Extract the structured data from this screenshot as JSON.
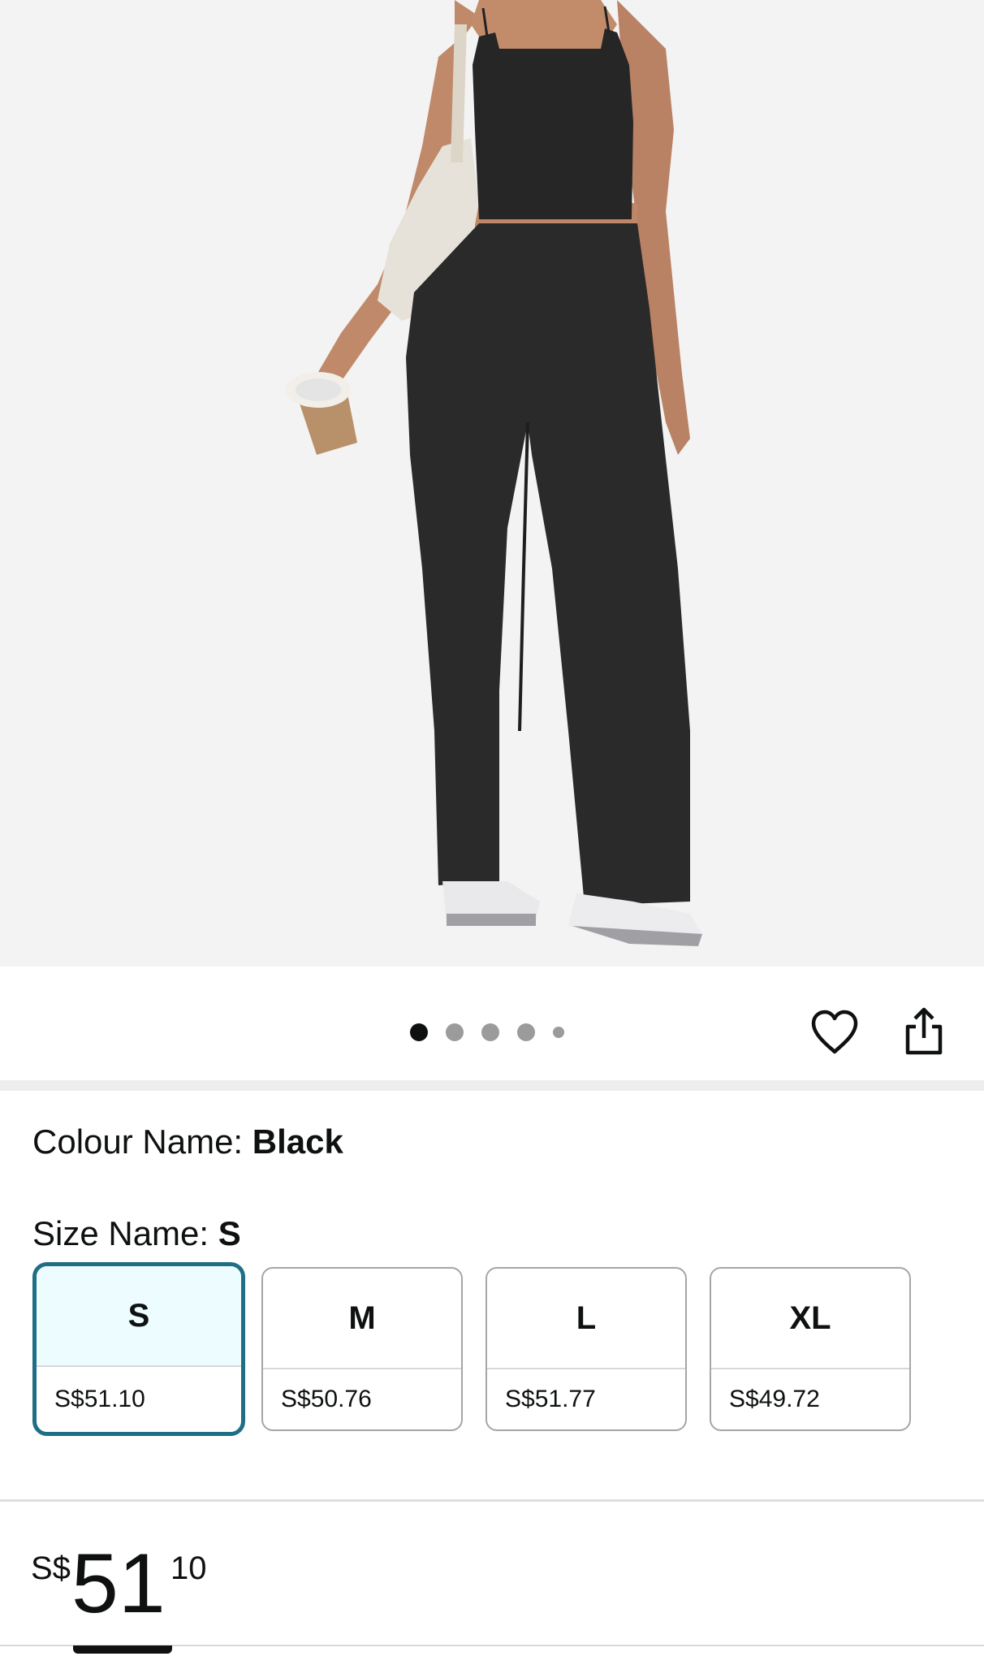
{
  "product": {
    "image_alt": "Model wearing black cropped cami top and black wide-leg pants, holding a tote bag and coffee cup"
  },
  "gallery": {
    "dot_count": 5,
    "active_index": 0
  },
  "actions": {
    "wishlist_icon": "heart-icon",
    "share_icon": "share-icon"
  },
  "colour": {
    "label": "Colour Name: ",
    "value": "Black"
  },
  "size": {
    "label": "Size Name: ",
    "value": "S",
    "options": [
      {
        "name": "S",
        "price": "S$51.10",
        "selected": true
      },
      {
        "name": "M",
        "price": "S$50.76",
        "selected": false
      },
      {
        "name": "L",
        "price": "S$51.77",
        "selected": false
      },
      {
        "name": "XL",
        "price": "S$49.72",
        "selected": false
      }
    ]
  },
  "price": {
    "symbol": "S$",
    "whole": "51",
    "fraction": "10"
  },
  "colors": {
    "selected_border": "#1e6e86",
    "selected_fill": "#edfdff",
    "gallery_bg": "#f3f3f3"
  }
}
